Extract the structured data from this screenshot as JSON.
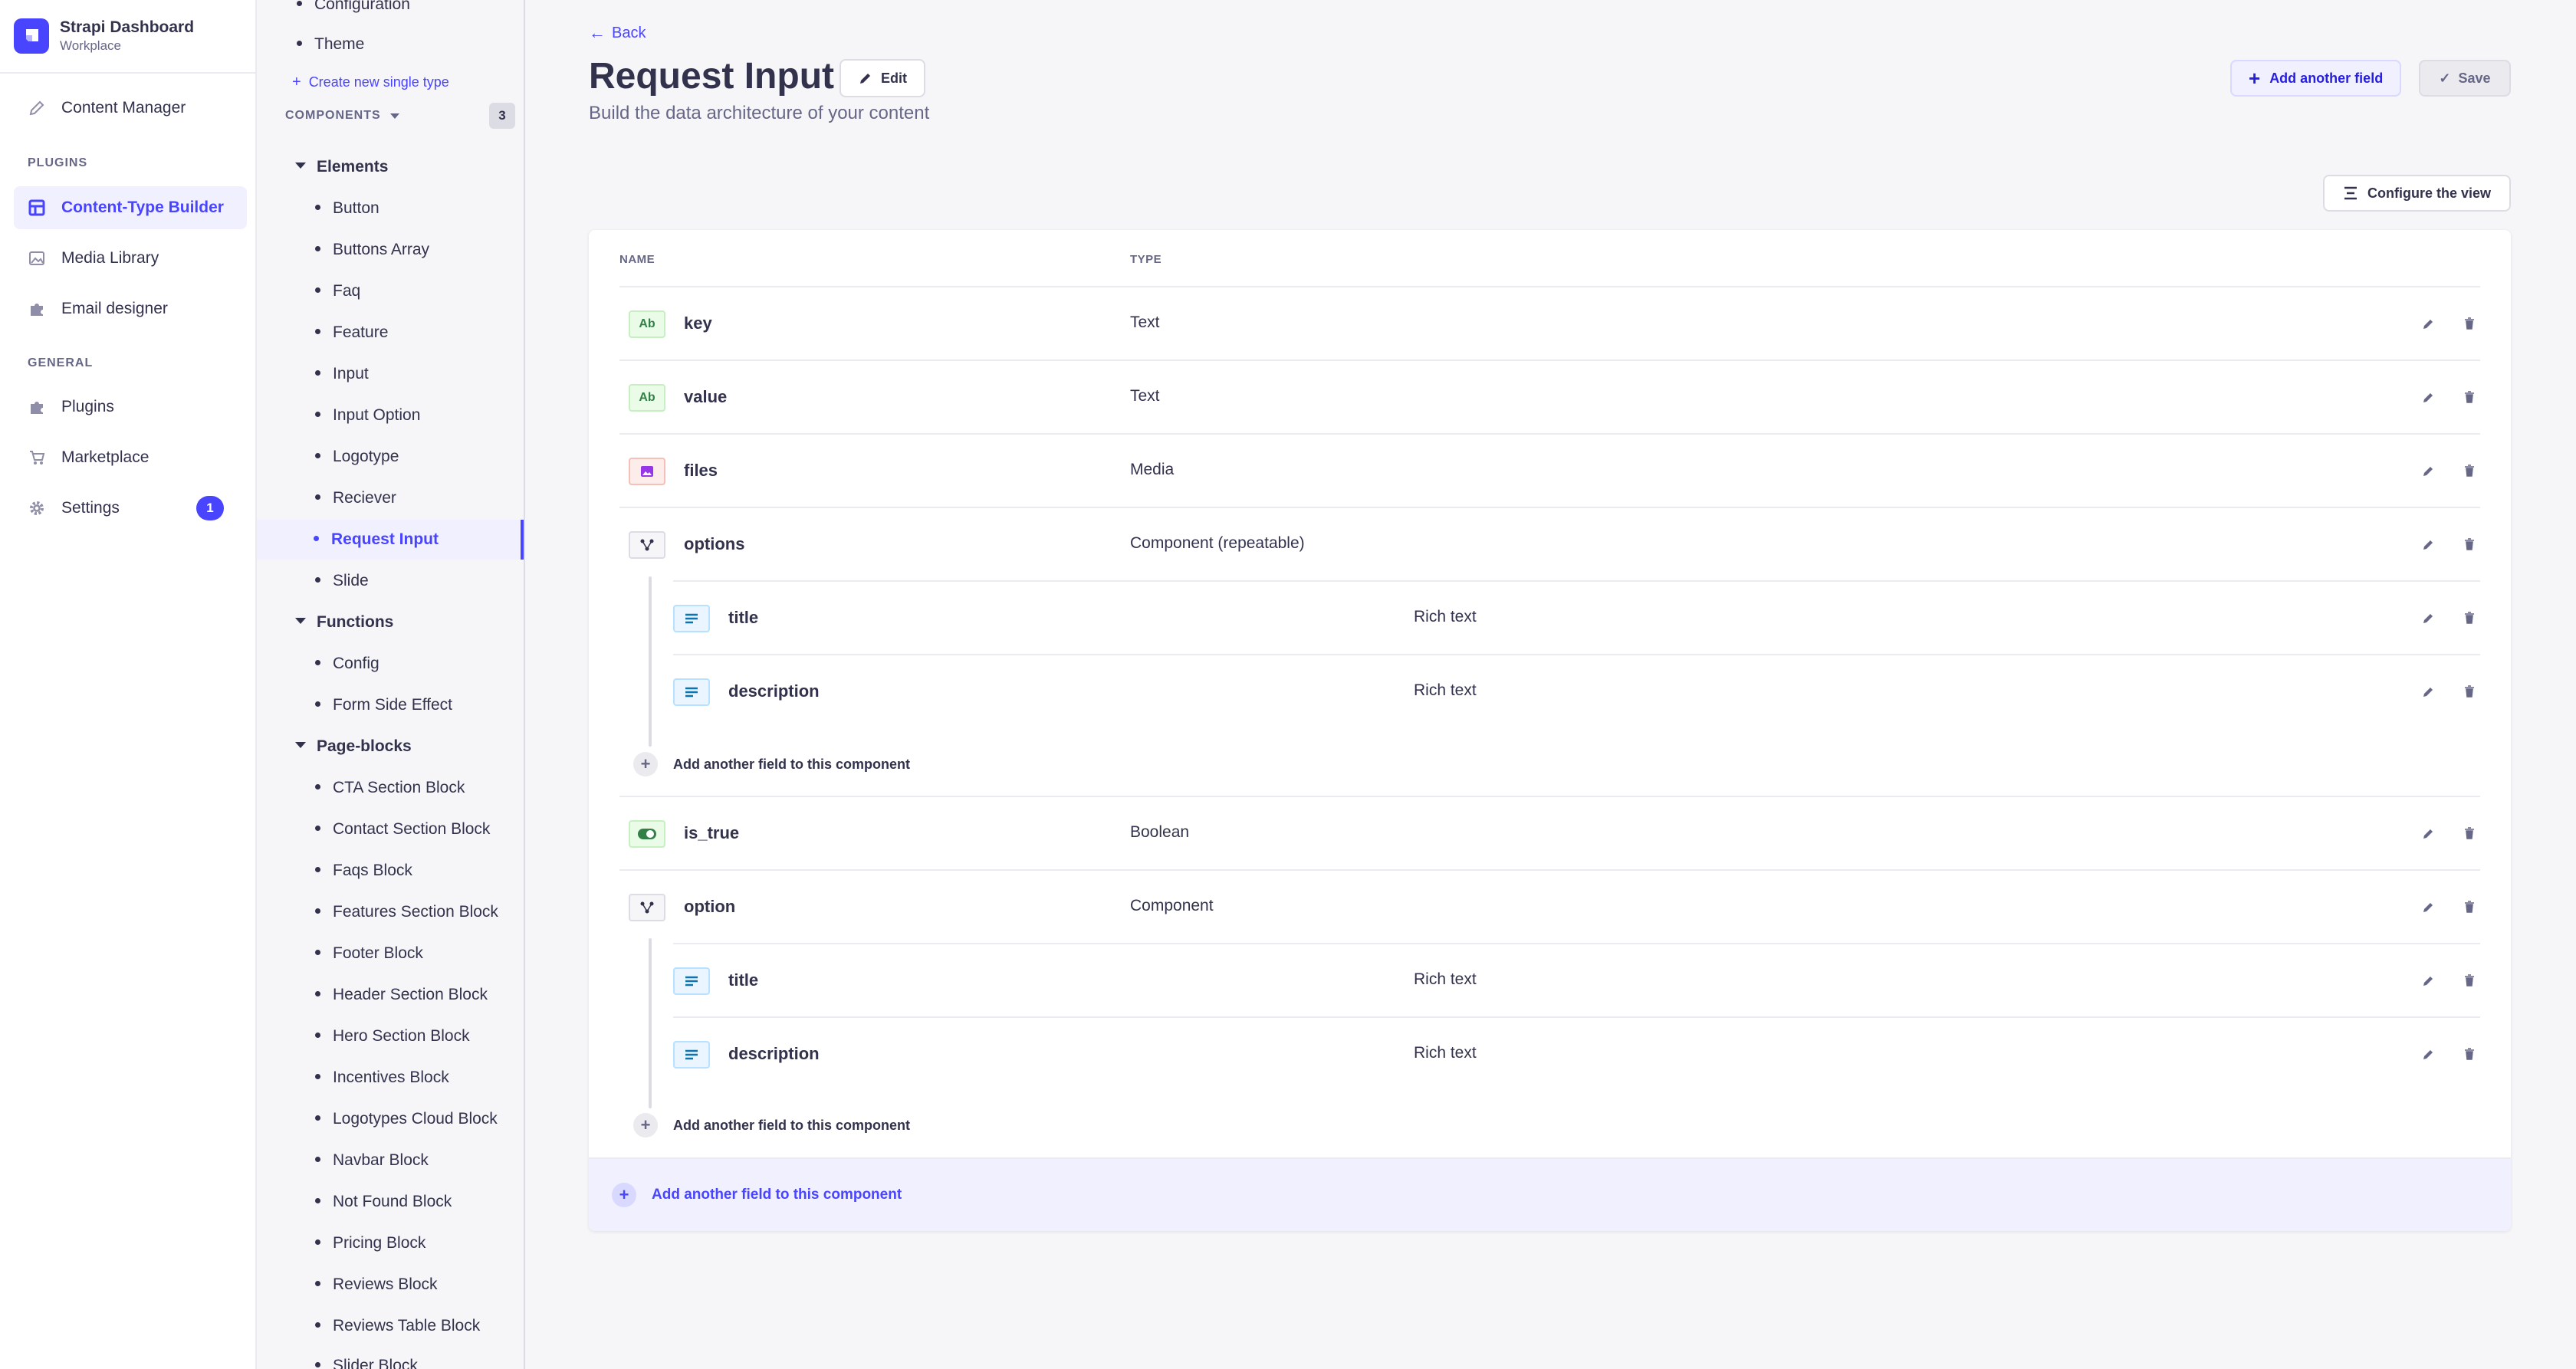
{
  "brand": {
    "title": "Strapi Dashboard",
    "subtitle": "Workplace"
  },
  "mainnav": {
    "content_manager": "Content Manager",
    "plugins_section": "PLUGINS",
    "content_type_builder": "Content-Type Builder",
    "media_library": "Media Library",
    "email_designer": "Email designer",
    "general_section": "GENERAL",
    "plugins": "Plugins",
    "marketplace": "Marketplace",
    "settings": "Settings",
    "settings_badge": "1"
  },
  "subnav": {
    "single_types": [
      "Configuration",
      "Theme"
    ],
    "create_single": "Create new single type",
    "components_label": "COMPONENTS",
    "components_count": "3",
    "groups": [
      {
        "name": "Elements",
        "items": [
          "Button",
          "Buttons Array",
          "Faq",
          "Feature",
          "Input",
          "Input Option",
          "Logotype",
          "Reciever",
          "Request Input",
          "Slide"
        ]
      },
      {
        "name": "Functions",
        "items": [
          "Config",
          "Form Side Effect"
        ]
      },
      {
        "name": "Page-blocks",
        "items": [
          "CTA Section Block",
          "Contact Section Block",
          "Faqs Block",
          "Features Section Block",
          "Footer Block",
          "Header Section Block",
          "Hero Section Block",
          "Incentives Block",
          "Logotypes Cloud Block",
          "Navbar Block",
          "Not Found Block",
          "Pricing Block",
          "Reviews Block",
          "Reviews Table Block",
          "Slider Block"
        ]
      }
    ]
  },
  "header": {
    "back": "Back",
    "title": "Request Input",
    "edit": "Edit",
    "subtitle": "Build the data architecture of your content",
    "add_field": "Add another field",
    "save": "Save",
    "configure": "Configure the view"
  },
  "table": {
    "col_name": "NAME",
    "col_type": "TYPE",
    "rows": [
      {
        "name": "key",
        "type": "Text",
        "icon": "Ab"
      },
      {
        "name": "value",
        "type": "Text",
        "icon": "Ab"
      },
      {
        "name": "files",
        "type": "Media"
      },
      {
        "name": "options",
        "type": "Component (repeatable)"
      },
      {
        "name": "title",
        "type": "Rich text"
      },
      {
        "name": "description",
        "type": "Rich text"
      },
      {
        "name": "is_true",
        "type": "Boolean"
      },
      {
        "name": "option",
        "type": "Component"
      },
      {
        "name": "title",
        "type": "Rich text"
      },
      {
        "name": "description",
        "type": "Rich text"
      }
    ],
    "add_to_component": "Add another field to this component"
  },
  "colors": {
    "primary": "#4945ff",
    "text": "#32324d",
    "muted": "#666687"
  }
}
